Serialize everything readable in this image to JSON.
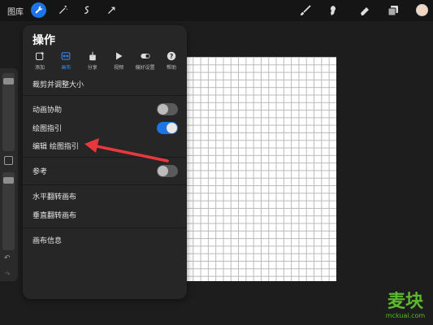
{
  "topbar": {
    "gallery_label": "图库",
    "left_tools": [
      "wrench-icon",
      "magic-wand-icon",
      "selection-icon",
      "transform-icon"
    ],
    "right_tools": [
      "brush-icon",
      "smudge-icon",
      "eraser-icon",
      "layers-icon"
    ],
    "color_swatch": "#f2d6bf",
    "accent": "#1e74e6"
  },
  "panel": {
    "title": "操作",
    "tabs": [
      {
        "label": "添加",
        "icon": "add-image-icon"
      },
      {
        "label": "画布",
        "icon": "canvas-icon",
        "active": true
      },
      {
        "label": "分享",
        "icon": "share-icon"
      },
      {
        "label": "视频",
        "icon": "video-play-icon"
      },
      {
        "label": "偏好设置",
        "icon": "toggle-prefs-icon"
      },
      {
        "label": "帮助",
        "icon": "help-icon"
      }
    ],
    "rows": {
      "crop_resize": "裁剪并调整大小",
      "animation_assist": "动画协助",
      "drawing_guide": "绘图指引",
      "edit_drawing_guide": "编辑 绘图指引",
      "reference": "参考",
      "flip_horizontal": "水平翻转画布",
      "flip_vertical": "垂直翻转画布",
      "canvas_info": "画布信息"
    },
    "toggles": {
      "animation_assist": false,
      "drawing_guide": true,
      "reference": false
    }
  },
  "sidebar": {
    "undo_icon": "undo-icon",
    "redo_icon": "redo-icon"
  },
  "annotation": {
    "arrow_color": "#e8383d"
  },
  "watermark": {
    "main": "麦块",
    "sub": "mckuai.com",
    "color": "#5cb82c"
  }
}
